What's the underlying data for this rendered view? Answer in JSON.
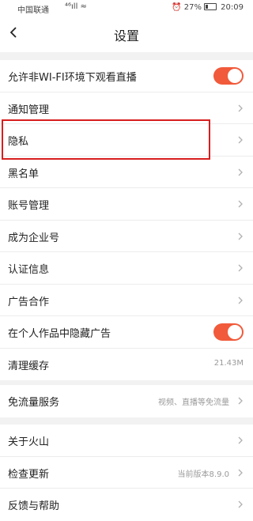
{
  "status_bar": {
    "carrier": "中国联通",
    "signal": "⁴⁶ıll ≈",
    "battery": "27%",
    "time": "20:09"
  },
  "header": {
    "title": "设置"
  },
  "section1": [
    {
      "label": "允许非WI-FI环境下观看直播",
      "type": "toggle",
      "on": true
    },
    {
      "label": "通知管理",
      "type": "link"
    },
    {
      "label": "隐私",
      "type": "link"
    },
    {
      "label": "黑名单",
      "type": "link"
    },
    {
      "label": "账号管理",
      "type": "link"
    },
    {
      "label": "成为企业号",
      "type": "link"
    },
    {
      "label": "认证信息",
      "type": "link"
    },
    {
      "label": "广告合作",
      "type": "link"
    },
    {
      "label": "在个人作品中隐藏广告",
      "type": "toggle",
      "on": true
    },
    {
      "label": "清理缓存",
      "type": "value",
      "value": "21.43M"
    }
  ],
  "section2": [
    {
      "label": "免流量服务",
      "type": "link-value",
      "value": "视频、直播等免流量"
    }
  ],
  "section3": [
    {
      "label": "关于火山",
      "type": "link"
    },
    {
      "label": "检查更新",
      "type": "link-value",
      "value": "当前版本8.9.0"
    },
    {
      "label": "反馈与帮助",
      "type": "link"
    }
  ],
  "colors": {
    "accent": "#f15a3a",
    "highlight": "#d81e1e"
  }
}
